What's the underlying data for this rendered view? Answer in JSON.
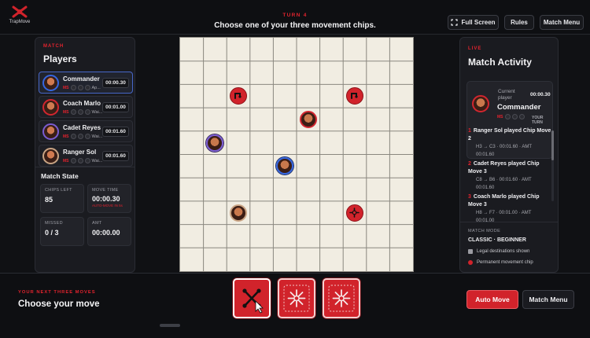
{
  "app": {
    "logo_text": "TrapMove"
  },
  "header": {
    "turn_label": "TURN 4",
    "instruction": "Choose one of your three movement chips.",
    "buttons": {
      "fullscreen": "Full Screen",
      "rules": "Rules",
      "match_menu": "Match Menu"
    }
  },
  "players_panel": {
    "kicker": "MATCH",
    "title": "Players",
    "players": [
      {
        "name": "Commander",
        "meta": "Ap...",
        "ms": "MS",
        "time": "00:00.30",
        "ring": "#3566e0",
        "active": true
      },
      {
        "name": "Coach Marlo",
        "meta": "Wai...",
        "ms": "MS",
        "time": "00:01.00",
        "ring": "#d2262f",
        "active": false
      },
      {
        "name": "Cadet Reyes",
        "meta": "Wai...",
        "ms": "MS",
        "time": "00:01.60",
        "ring": "#7a5cd2",
        "active": false
      },
      {
        "name": "Ranger Sol",
        "meta": "Wai...",
        "ms": "MS",
        "time": "00:01.60",
        "ring": "#c9a484",
        "active": false
      }
    ],
    "match_state": {
      "title": "Match State",
      "chips_left_label": "CHIPS LEFT",
      "chips_left": "85",
      "move_time_label": "MOVE TIME",
      "move_time": "00:00.30",
      "move_time_sub": "AUTO-MOVE IN 5s",
      "missed_label": "MISSED",
      "missed": "0 / 3",
      "amt_label": "AMT",
      "amt": "00:00.00"
    }
  },
  "board": {
    "cols": 10,
    "rows": 10,
    "pieces": [
      {
        "type": "chip",
        "icon": "hook",
        "col": 2.5,
        "row": 2.5
      },
      {
        "type": "chip",
        "icon": "hook",
        "col": 7.5,
        "row": 2.5
      },
      {
        "type": "portrait",
        "ring": "red",
        "col": 5.5,
        "row": 3.5
      },
      {
        "type": "portrait",
        "ring": "purple",
        "col": 1.5,
        "row": 4.5
      },
      {
        "type": "portrait",
        "ring": "blue",
        "col": 4.5,
        "row": 5.5
      },
      {
        "type": "portrait",
        "ring": "tan",
        "col": 2.5,
        "row": 7.5
      },
      {
        "type": "chip",
        "icon": "compass",
        "col": 7.5,
        "row": 7.5
      }
    ]
  },
  "activity_panel": {
    "kicker": "LIVE",
    "title": "Match Activity",
    "current": {
      "label": "Current player",
      "time": "00:00.30",
      "name": "Commander",
      "ms": "MS",
      "status": "YOUR TURN"
    },
    "entries": [
      {
        "num": "1",
        "text": "Ranger Sol played Chip Move 2",
        "meta1": "H3 → C3 · 00:01.60 · AMT",
        "meta2": "00:01.60"
      },
      {
        "num": "2",
        "text": "Cadet Reyes played Chip Move 3",
        "meta1": "C8 → B6 · 00:01.60 · AMT",
        "meta2": "00:01.60"
      },
      {
        "num": "3",
        "text": "Coach Marlo played Chip Move 3",
        "meta1": "H8 → F7 · 00:01.00 · AMT",
        "meta2": "00:01.00"
      }
    ],
    "mode_label": "MATCH MODE",
    "mode_value": "CLASSIC · BEGINNER",
    "legend": [
      {
        "label": "Legal destinations shown",
        "color": "#9b9ba2"
      },
      {
        "label": "Permanent movement chip",
        "color": "#d1232b"
      }
    ]
  },
  "bottom": {
    "kicker": "YOUR NEXT THREE MOVES",
    "title": "Choose your move",
    "chips": [
      {
        "icon": "x-arrows-icon",
        "selected": true
      },
      {
        "icon": "starburst-icon",
        "selected": false
      },
      {
        "icon": "starburst-icon",
        "selected": false
      }
    ],
    "auto_move": "Auto Move",
    "match_menu": "Match Menu"
  },
  "colors": {
    "accent": "#d1232b",
    "background": "#101114",
    "board": "#f1ede2"
  }
}
